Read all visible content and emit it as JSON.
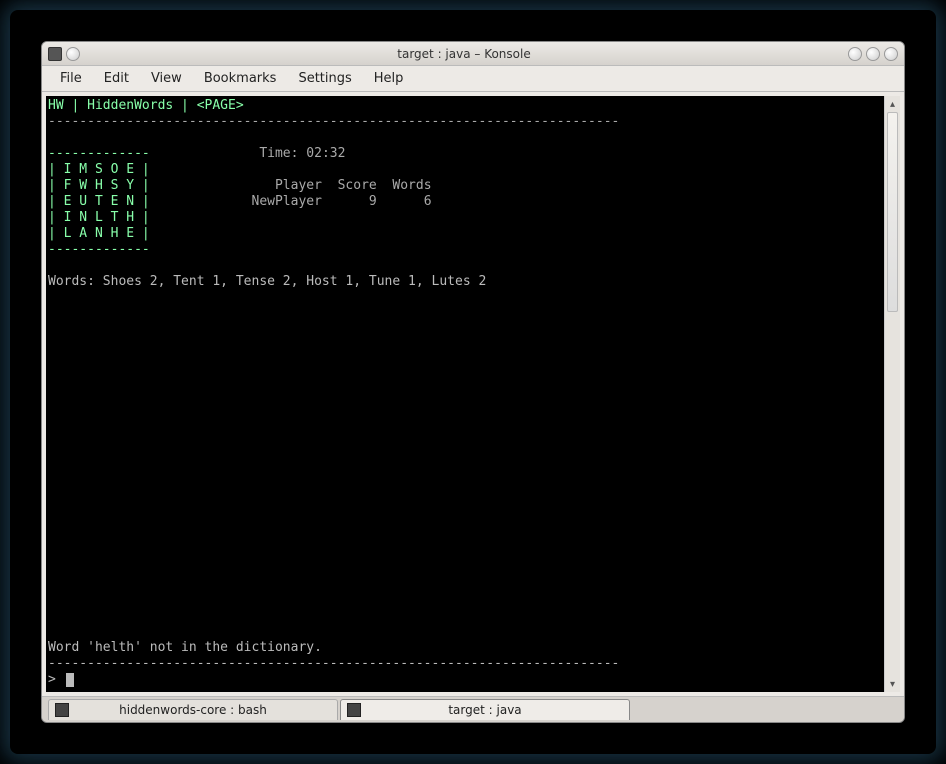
{
  "window": {
    "title": "target : java – Konsole"
  },
  "menubar": {
    "items": [
      "File",
      "Edit",
      "View",
      "Bookmarks",
      "Settings",
      "Help"
    ]
  },
  "terminal": {
    "header_line": "HW | HiddenWords | <PAGE>",
    "top_divider": "-------------------------------------------------------------------------",
    "grid_top": "-------------",
    "grid_rows": [
      "| I M S O E |",
      "| F W H S Y |",
      "| E U T E N |",
      "| I N L T H |",
      "| L A N H E |"
    ],
    "grid_bottom": "-------------",
    "time_label": "Time: 02:32",
    "score_header": "           Player  Score  Words",
    "score_row": "        NewPlayer      9      6",
    "words_line": "Words: Shoes 2, Tent 1, Tense 2, Host 1, Tune 1, Lutes 2",
    "error_line": "Word 'helth' not in the dictionary.",
    "bottom_divider": "-------------------------------------------------------------------------",
    "prompt": "> "
  },
  "bottom_tabs": {
    "tab1": "hiddenwords-core : bash",
    "tab2": "target : java"
  }
}
